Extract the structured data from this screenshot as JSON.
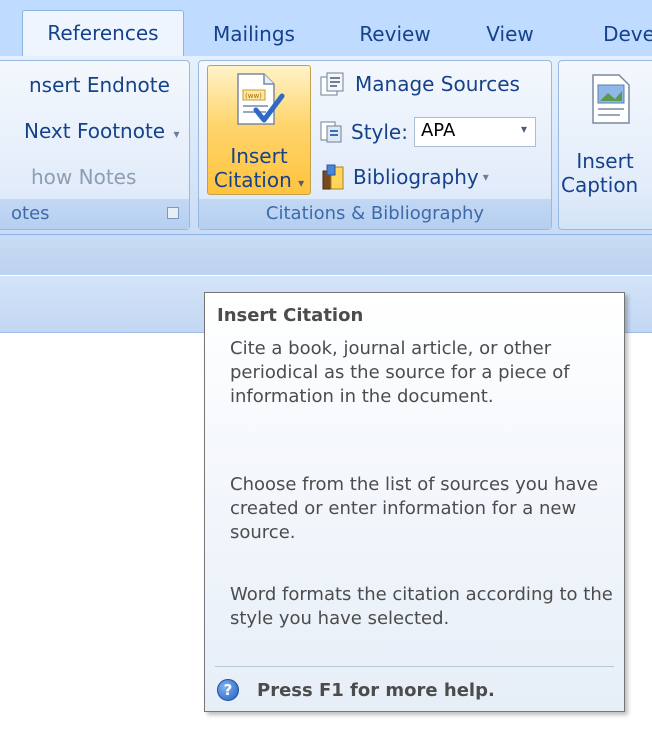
{
  "tabs": [
    {
      "label": "References",
      "active": true
    },
    {
      "label": "Mailings"
    },
    {
      "label": "Review"
    },
    {
      "label": "View"
    },
    {
      "label": "Deve"
    }
  ],
  "footnotes_group": {
    "insert_endnote": "nsert Endnote",
    "next_footnote": "Next Footnote",
    "show_notes": "how Notes",
    "label": "otes"
  },
  "citations_group": {
    "insert_citation_line1": "Insert",
    "insert_citation_line2": "Citation",
    "manage_sources": "Manage Sources",
    "style_label": "Style:",
    "style_value": "APA",
    "bibliography": "Bibliography",
    "label": "Citations & Bibliography"
  },
  "captions_group": {
    "insert_caption_line1": "Insert",
    "insert_caption_line2": "Caption"
  },
  "tooltip": {
    "title": "Insert Citation",
    "para1": "Cite a book, journal article, or other periodical as the source for a piece of information in the document.",
    "para2": "Choose from the list of sources you have created or enter information for a new source.",
    "para3": "Word formats the citation according to the style you have selected.",
    "help": "Press F1 for more help."
  },
  "colors": {
    "accent": "#15428b",
    "highlight": "#ffc33d",
    "ribbon_bg": "#dbe8fb"
  }
}
